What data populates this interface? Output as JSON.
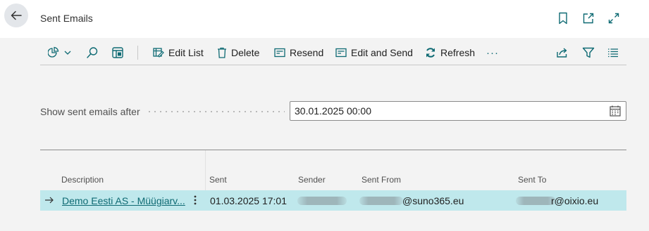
{
  "page": {
    "title": "Sent Emails"
  },
  "icons": {
    "back": "arrow-left-icon",
    "bookmark": "bookmark-icon",
    "open_new": "open-in-new-window-icon",
    "expand": "expand-icon",
    "analysis": "data-analysis-icon",
    "search": "search-icon",
    "layout": "table-layout-icon",
    "share": "share-icon",
    "filter": "filter-icon",
    "list_view": "list-view-icon",
    "calendar": "calendar-icon"
  },
  "actions": {
    "edit_list": "Edit List",
    "delete": "Delete",
    "resend": "Resend",
    "edit_and_send": "Edit and Send",
    "refresh": "Refresh",
    "more": "···"
  },
  "filter": {
    "label": "Show sent emails after",
    "value": "30.01.2025 00:00"
  },
  "table": {
    "columns": [
      "Description",
      "Sent",
      "Sender",
      "Sent From",
      "Sent To"
    ],
    "rows": [
      {
        "description": "Demo Eesti AS - Müügiarv...",
        "sent": "01.03.2025 17:01",
        "sent_from_domain": "@suno365.eu",
        "sent_to_domain": "r@oixio.eu"
      }
    ]
  },
  "colors": {
    "accent": "#0e6a73",
    "selected_row": "#bfe8ec",
    "background": "#f3f3f3"
  }
}
